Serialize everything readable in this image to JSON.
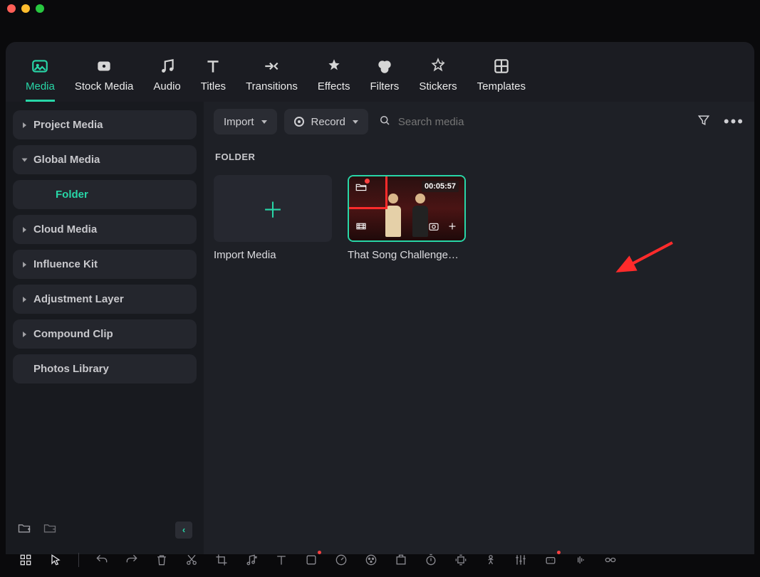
{
  "tabs": {
    "media": "Media",
    "stock": "Stock Media",
    "audio": "Audio",
    "titles": "Titles",
    "transitions": "Transitions",
    "effects": "Effects",
    "filters": "Filters",
    "stickers": "Stickers",
    "templates": "Templates"
  },
  "sidebar": {
    "project_media": "Project Media",
    "global_media": "Global Media",
    "folder": "Folder",
    "cloud_media": "Cloud Media",
    "influence_kit": "Influence Kit",
    "adjustment_layer": "Adjustment Layer",
    "compound_clip": "Compound Clip",
    "photos_library": "Photos Library"
  },
  "toolbar": {
    "import": "Import",
    "record": "Record",
    "search_placeholder": "Search media"
  },
  "content": {
    "section_title": "FOLDER",
    "import_label": "Import Media",
    "clip": {
      "duration": "00:05:57",
      "name": "That Song Challenge…"
    }
  }
}
